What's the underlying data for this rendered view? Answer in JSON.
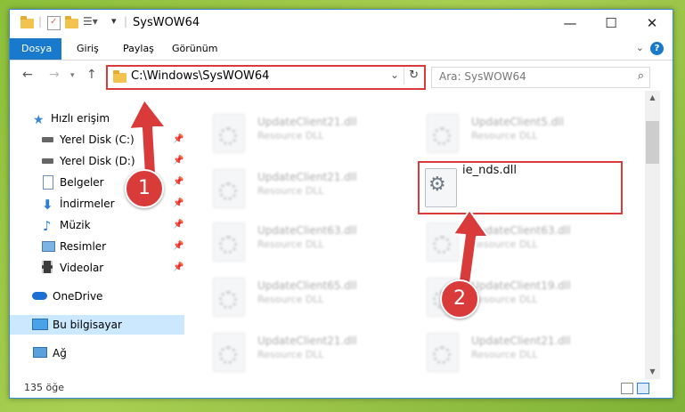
{
  "window": {
    "title": "SysWOW64",
    "controls": {
      "minimize": "—",
      "maximize": "☐",
      "close": "✕"
    }
  },
  "ribbon": {
    "tabs": [
      "Dosya",
      "Giriş",
      "Paylaş",
      "Görünüm"
    ],
    "help": "?"
  },
  "nav": {
    "address": "C:\\Windows\\SysWOW64",
    "search_placeholder": "Ara: SysWOW64"
  },
  "sidebar": {
    "items": [
      {
        "label": "Hızlı erişim",
        "icon": "star-icon"
      },
      {
        "label": "Yerel Disk (C:)",
        "icon": "drive-icon"
      },
      {
        "label": "Yerel Disk (D:)",
        "icon": "drive-icon"
      },
      {
        "label": "Belgeler",
        "icon": "documents-icon"
      },
      {
        "label": "İndirmeler",
        "icon": "download-icon"
      },
      {
        "label": "Müzik",
        "icon": "music-icon"
      },
      {
        "label": "Resimler",
        "icon": "pictures-icon"
      },
      {
        "label": "Videolar",
        "icon": "video-icon"
      },
      {
        "label": "OneDrive",
        "icon": "cloud-icon"
      },
      {
        "label": "Bu bilgisayar",
        "icon": "computer-icon"
      },
      {
        "label": "Ağ",
        "icon": "network-icon"
      }
    ]
  },
  "files": [
    {
      "name": "UpdateClient21.dll",
      "type": "Resource DLL"
    },
    {
      "name": "UpdateClient5.dll",
      "type": "Resource DLL"
    },
    {
      "name": "UpdateClient21.dll",
      "type": "Resource DLL"
    },
    {
      "name": "ie_nds.dll",
      "type": ""
    },
    {
      "name": "UpdateClient63.dll",
      "type": "Resource DLL"
    },
    {
      "name": "UpdateClient63.dll",
      "type": "Resource DLL"
    },
    {
      "name": "UpdateClient65.dll",
      "type": "Resource DLL"
    },
    {
      "name": "UpdateClient19.dll",
      "type": "Resource DLL"
    },
    {
      "name": "UpdateClient21.dll",
      "type": "Resource DLL"
    },
    {
      "name": "UpdateClient21.dll",
      "type": "Resource DLL"
    }
  ],
  "status": {
    "count": "135 öğe"
  },
  "callouts": {
    "one": "1",
    "two": "2"
  },
  "colors": {
    "accent": "#1979ca",
    "highlight": "#d93a3a",
    "selected": "#cce8ff"
  }
}
